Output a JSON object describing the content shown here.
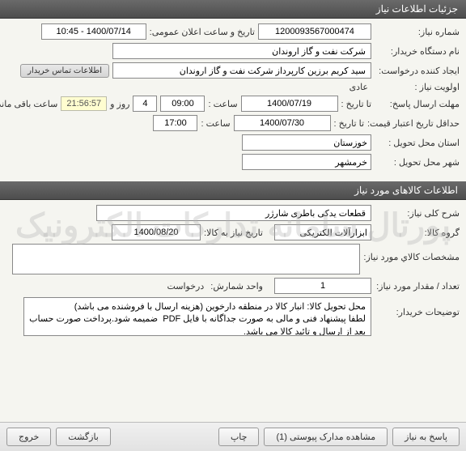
{
  "headers": {
    "details": "جزئیات اطلاعات نیاز",
    "goods": "اطلاعات کالاهای مورد نیاز"
  },
  "labels": {
    "need_no": "شماره نیاز:",
    "announce": "تاریخ و ساعت اعلان عمومی:",
    "buyer": "نام دستگاه خریدار:",
    "requester": "ایجاد کننده درخواست:",
    "priority": "اولویت نیاز :",
    "resp_deadline": "مهلت ارسال پاسخ:",
    "to_date": "تا تاریخ :",
    "time": "ساعت :",
    "days_and": "روز و",
    "remaining": "ساعت باقی مانده",
    "price_validity": "حداقل تاریخ اعتبار قیمت:",
    "delivery_prov": "استان محل تحویل :",
    "delivery_city": "شهر محل تحویل :",
    "gen_desc": "شرح کلی نیاز:",
    "goods_group": "گروه کالا:",
    "need_date": "تاریخ نیاز به کالا:",
    "goods_spec": "مشخصات کالاي مورد نیاز:",
    "qty": "تعداد / مقدار مورد نیاز:",
    "unit": "واحد شمارش:",
    "buyer_notes": "توضیحات خریدار:"
  },
  "values": {
    "need_no": "1200093567000474",
    "announce": "1400/07/14 - 10:45",
    "buyer_name": "شرکت نفت و گاز اروندان",
    "requester_name": "سید کریم برزین کارپرداز شرکت نفت و گاز اروندان",
    "priority": "عادی",
    "resp_date": "1400/07/19",
    "resp_time": "09:00",
    "days_left": "4",
    "time_left": "21:56:57",
    "price_date": "1400/07/30",
    "price_time": "17:00",
    "province": "خوزستان",
    "city": "خرمشهر",
    "gen_desc": "قطعات یدکی باطری شارژر",
    "goods_group": "ابزارآلات الکتریکی",
    "need_date": "1400/08/20",
    "goods_spec": "",
    "qty": "1",
    "unit": "درخواست",
    "buyer_notes": "محل تحویل کالا: انبار کالا در منطقه دارخوین (هزینه ارسال با فروشنده می باشد)\nلطفا پیشنهاد فنی و مالی به صورت جداگانه با فایل PDF  ضمیمه شود.پرداخت صورت حساب بعد از ارسال و تائید کالا می باشد."
  },
  "badges": {
    "contact": "اطلاعات تماس خریدار"
  },
  "buttons": {
    "respond": "پاسخ به نیاز",
    "attachments": "مشاهده مدارک پیوستی (1)",
    "print": "چاپ",
    "back": "بازگشت",
    "exit": "خروج"
  },
  "watermark": "پورتال سامانه تدارکات الکترونیک"
}
